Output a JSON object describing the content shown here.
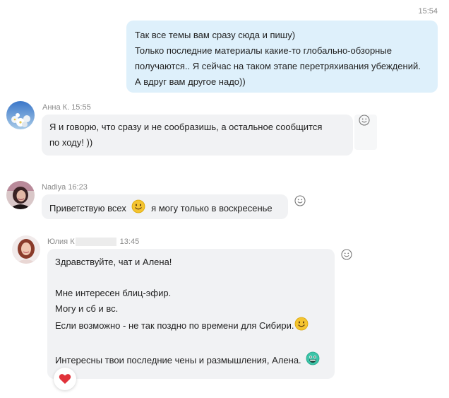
{
  "messages": {
    "outgoing": {
      "time": "15:54",
      "lines": [
        "Так все темы вам сразу сюда и пишу)",
        "Только последние материалы какие-то глобально-обзорные",
        "получаются.. Я сейчас на таком этапе перетряхивания убеждений.",
        "А вдруг вам другое надо))"
      ]
    },
    "anna": {
      "sender": "Анна К.",
      "time": "15:55",
      "lines": [
        "Я и говорю, что сразу и не сообразишь, а остальное сообщится",
        "по ходу! ))"
      ]
    },
    "nadiya": {
      "sender": "Nadiya",
      "time": "16:23",
      "text_before": "Приветствую всех",
      "text_after": "я могу только в воскресенье"
    },
    "yulia": {
      "sender": "Юлия К",
      "time": "13:45",
      "lines": [
        "Здравствуйте, чат и Алена!",
        "",
        "Мне интересен блиц-эфир.",
        "Могу и сб и вс.",
        "Если возможно - не так поздно по времени для Сибири.",
        "",
        "Интересны твои последние чены и размышления, Алена."
      ]
    }
  },
  "colors": {
    "outgoing_bubble": "#def0fb",
    "incoming_bubble": "#f1f2f4",
    "reaction_heart": "#e0323a"
  },
  "icons": {
    "react": "smile-icon",
    "reaction": "heart-icon",
    "emoji_smile": "smiling-face-emoji",
    "emoji_grin": "grinning-face-emoji"
  }
}
